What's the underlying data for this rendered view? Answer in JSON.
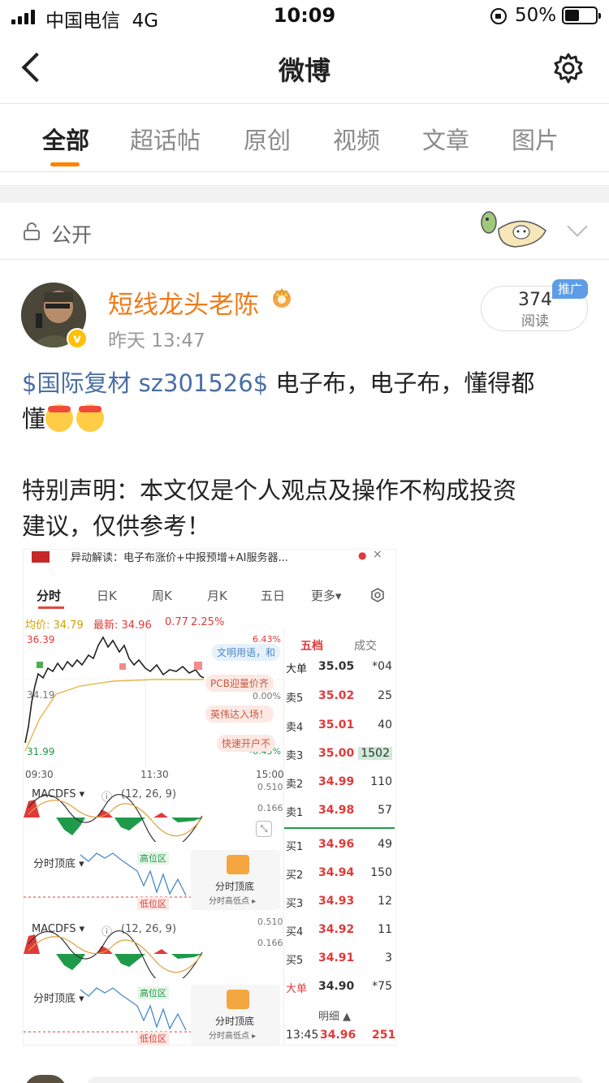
{
  "status_bar": {
    "carrier": "中国电信",
    "network": "4G",
    "time": "10:09",
    "battery": "50%"
  },
  "nav": {
    "title": "微博"
  },
  "tabs": [
    {
      "label": "全部",
      "active": true
    },
    {
      "label": "超话帖",
      "active": false
    },
    {
      "label": "原创",
      "active": false
    },
    {
      "label": "视频",
      "active": false
    },
    {
      "label": "文章",
      "active": false
    },
    {
      "label": "图片",
      "active": false
    }
  ],
  "visibility": {
    "label": "公开"
  },
  "post": {
    "username": "短线龙头老陈",
    "time": "昨天 13:47",
    "read_count": "374",
    "read_label": "阅读",
    "promo_badge": "推广",
    "topic": "$国际复材 sz301526$",
    "text_line1": " 电子布，电子布，懂得都",
    "text_line2": "懂",
    "disclaimer_line1": "特别声明：本文仅是个人观点及操作不构成投资",
    "disclaimer_line2": "建议，仅供参考！"
  },
  "image": {
    "headline": "异动解读：电子布涨价+中报预增+AI服务器...",
    "tabs": [
      "分时",
      "日K",
      "周K",
      "月K",
      "五日",
      "更多▾"
    ],
    "price_line": {
      "avg_label": "均价: 34.79",
      "last_label": "最新: 34.96",
      "change": "0.77",
      "pct": "2.25%"
    },
    "y_labels": {
      "high": "36.39",
      "mid": "34.19",
      "low": "31.99",
      "pct_high": "6.43%",
      "pct_mid": "0.00%",
      "pct_low": "-6.43%"
    },
    "x_labels": [
      "09:30",
      "11:30",
      "15:00"
    ],
    "bubbles": [
      "文明用语，和",
      "PCB迎量价齐",
      "英伟达入场！",
      "快速开户不"
    ],
    "macd": {
      "label": "MACDFS ▾",
      "params": "(12, 26, 9)",
      "v1": "0.510",
      "v2": "0.166"
    },
    "bottom_panel": {
      "label": "分时顶底 ▾",
      "high_zone": "高位区",
      "low_zone": "低位区",
      "card_title": "分时顶底",
      "card_sub": "分时高低点 ▸"
    },
    "orderbook": {
      "tabs": [
        "五档",
        "成交"
      ],
      "rows": [
        {
          "label": "大单",
          "price": "35.05",
          "vol": "*04",
          "color": "normal"
        },
        {
          "label": "卖5",
          "price": "35.02",
          "vol": "25",
          "color": "red"
        },
        {
          "label": "卖4",
          "price": "35.01",
          "vol": "40",
          "color": "red"
        },
        {
          "label": "卖3",
          "price": "35.00",
          "vol": "1502",
          "color": "red"
        },
        {
          "label": "卖2",
          "price": "34.99",
          "vol": "110",
          "color": "red"
        },
        {
          "label": "卖1",
          "price": "34.98",
          "vol": "57",
          "color": "red"
        },
        {
          "label": "买1",
          "price": "34.96",
          "vol": "49",
          "color": "red"
        },
        {
          "label": "买2",
          "price": "34.94",
          "vol": "150",
          "color": "red"
        },
        {
          "label": "买3",
          "price": "34.93",
          "vol": "12",
          "color": "red"
        },
        {
          "label": "买4",
          "price": "34.92",
          "vol": "11",
          "color": "red"
        },
        {
          "label": "买5",
          "price": "34.91",
          "vol": "3",
          "color": "red"
        },
        {
          "label": "大单",
          "price": "34.90",
          "vol": "*75",
          "color": "normal"
        }
      ],
      "detail_label": "明细 ▲",
      "last_trade": {
        "time": "13:45",
        "price": "34.96",
        "vol": "251"
      }
    }
  },
  "colors": {
    "accent": "#ff8200",
    "username": "#ee7b1a",
    "topic": "#4a6fa5",
    "up": "#e03a3a",
    "down": "#1f9a4b"
  }
}
